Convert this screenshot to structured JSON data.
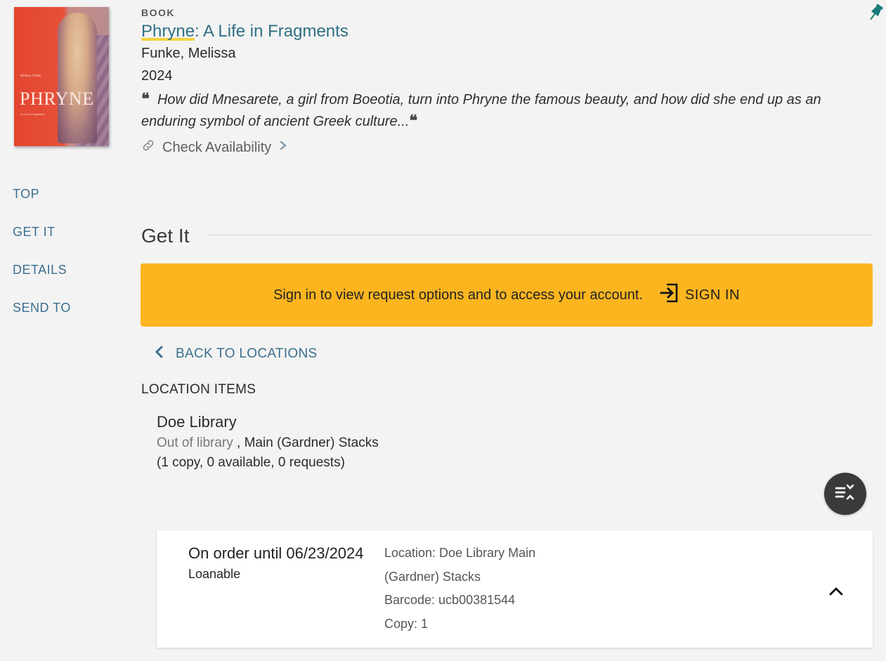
{
  "record": {
    "type": "BOOK",
    "title_highlight": "Phryne",
    "title_rest": ": A Life in Fragments",
    "author": "Funke, Melissa",
    "year": "2024",
    "description": "How did Mnesarete, a girl from Boeotia, turn into Phryne the famous beauty, and how did she end up as an enduring symbol of ancient Greek culture...",
    "availability_label": "Check Availability",
    "cover": {
      "author_line": "Melissa Funke",
      "title": "PHRYNE",
      "subtitle": "A Life in Fragments"
    }
  },
  "nav": {
    "items": [
      "TOP",
      "GET IT",
      "DETAILS",
      "SEND TO"
    ]
  },
  "get_it": {
    "heading": "Get It",
    "signin_message": "Sign in to view request options and to access your account.",
    "signin_label": "SIGN IN",
    "back_label": "BACK TO LOCATIONS",
    "location_items_label": "LOCATION ITEMS",
    "library": {
      "name": "Doe Library",
      "status": "Out of library",
      "sublocation": ", Main (Gardner) Stacks",
      "counts": "(1 copy, 0 available, 0 requests)"
    },
    "item": {
      "status": "On order until 06/23/2024",
      "policy": "Loanable",
      "location_line1": "Location: Doe Library Main",
      "location_line2": "(Gardner) Stacks",
      "barcode": "Barcode: ucb00381544",
      "copy": "Copy: 1"
    }
  },
  "colors": {
    "link": "#2f6f84",
    "nav": "#3b6f8f",
    "signin_bar": "#fcb51f",
    "highlight": "#f6d33b",
    "pin": "#1a7a7a"
  },
  "icons": {
    "pin": "pushpin-icon",
    "link": "link-icon",
    "chevron": "chevron-right-icon",
    "signin": "sign-in-icon",
    "back": "chevron-left-icon",
    "fab": "expand-collapse-list-icon",
    "collapse": "chevron-up-icon"
  }
}
